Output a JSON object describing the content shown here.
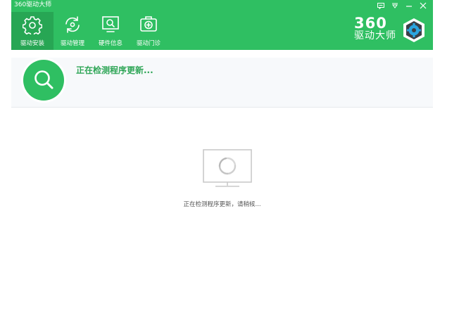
{
  "window": {
    "title": "360驱动大师"
  },
  "nav": {
    "items": [
      {
        "label": "驱动安装",
        "icon": "gear-icon",
        "active": true
      },
      {
        "label": "驱动管理",
        "icon": "refresh-icon",
        "active": false
      },
      {
        "label": "硬件信息",
        "icon": "monitor-search-icon",
        "active": false
      },
      {
        "label": "驱动门诊",
        "icon": "medical-kit-icon",
        "active": false
      }
    ]
  },
  "brand": {
    "number": "360",
    "name": "驱动大师"
  },
  "status": {
    "title": "正在检测程序更新..."
  },
  "loading": {
    "text": "正在检测程序更新，请稍候..."
  },
  "colors": {
    "accent": "#2fbf62",
    "active_tab": "#27a654",
    "status_text": "#2fa657"
  }
}
